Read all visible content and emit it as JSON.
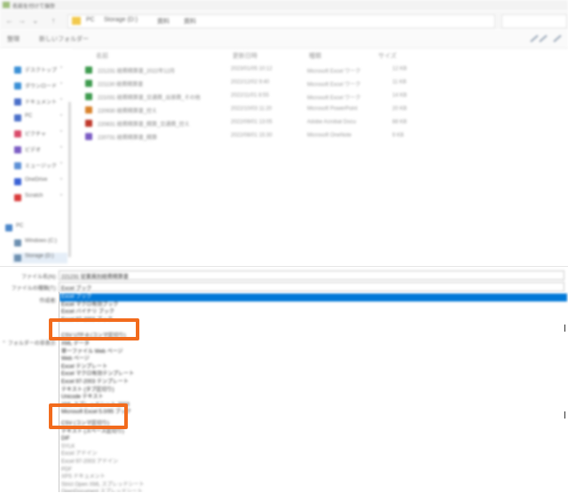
{
  "titlebar": {
    "title": "名前を付けて保存"
  },
  "addressbar": {
    "crumbs": [
      "PC",
      "Storage (D:)",
      "資料",
      "資料"
    ]
  },
  "commandbar": {
    "organize": "整理",
    "new_folder": "新しいフォルダー"
  },
  "file_list": {
    "columns": [
      "名前",
      "更新日時",
      "種類",
      "サイズ"
    ],
    "rows": [
      {
        "color": "#3e9b4f",
        "name": "221231 経費精算書_2022年12月",
        "date": "2023/01/05 10:12",
        "type": "Microsoft Excel ワーク",
        "size": "12 KB"
      },
      {
        "color": "#3e9b4f",
        "name": "221130 経費精算書",
        "date": "2022/12/02 9:40",
        "type": "Microsoft Excel ワーク",
        "size": "11 KB"
      },
      {
        "color": "#3e9b4f",
        "name": "221031 経費精算書_交通費_出張費_その他",
        "date": "2022/11/01 8:55",
        "type": "Microsoft Excel ワーク",
        "size": "14 KB"
      },
      {
        "color": "#d9822b",
        "name": "220930 経費精算書_控え",
        "date": "2022/10/03 11:20",
        "type": "Microsoft PowerPoint",
        "size": "20 KB"
      },
      {
        "color": "#c0392b",
        "name": "220831 経費精算書_精算_交通費_控え",
        "date": "2022/09/01 13:05",
        "type": "Adobe Acrobat Docu",
        "size": "88 KB"
      },
      {
        "color": "#7b5cc4",
        "name": "220731 経費精算書_精算",
        "date": "2022/08/01 15:30",
        "type": "Microsoft OneNote",
        "size": "9 KB"
      }
    ]
  },
  "navpane": {
    "quick": [
      {
        "label": "デスクトップ",
        "color": "#3a8fd6"
      },
      {
        "label": "ダウンロード",
        "color": "#3a8fd6"
      },
      {
        "label": "ドキュメント",
        "color": "#4a6fc9"
      },
      {
        "label": "PC",
        "color": "#4a6fc9"
      },
      {
        "label": "ピクチャ",
        "color": "#d94b6a"
      },
      {
        "label": "ビデオ",
        "color": "#7b5cc4"
      },
      {
        "label": "ミュージック",
        "color": "#5c8fd6"
      },
      {
        "label": "OneDrive",
        "color": "#3a62d6"
      },
      {
        "label": "Scratch",
        "color": "#d93a3a"
      }
    ],
    "pc_label": "PC",
    "drives": [
      "Windows (C:)",
      "Storage (D:)"
    ]
  },
  "form": {
    "filename_label": "ファイル名(N):",
    "filename_value": "221231 従業員別経費精算書",
    "filetype_label": "ファイルの種類(T):",
    "filetype_value": "Excel ブック",
    "author_label": "作成者:",
    "hide_folders": "フォルダーの非表示"
  },
  "dropdown": {
    "options": [
      "Excel ブック",
      "Excel マクロ有効ブック",
      "Excel バイナリ ブック",
      "Excel 97-2003 ブック",
      "CSV UTF-8 (コンマ区切り)",
      "XML データ",
      "単一ファイル Web ページ",
      "Web ページ",
      "Excel テンプレート",
      "Excel マクロ有効テンプレート",
      "Excel 97-2003 テンプレート",
      "テキスト (タブ区切り)",
      "Unicode テキスト",
      "XML スプレッドシート 2003",
      "Microsoft Excel 5.0/95 ブック",
      "CSV (コンマ区切り)",
      "テキスト (スペース区切り)",
      "DIF",
      "SYLK",
      "Excel アドイン",
      "Excel 97-2003 アドイン",
      "PDF",
      "XPS ドキュメント",
      "Strict Open XML スプレッドシート",
      "OpenDocument スプレッドシート"
    ],
    "selected_index": 0,
    "highlighted": [
      "CSV UTF-8 (コンマ区切り)",
      "CSV (コンマ区切り)"
    ],
    "highlight_color": "#f26b1d"
  }
}
